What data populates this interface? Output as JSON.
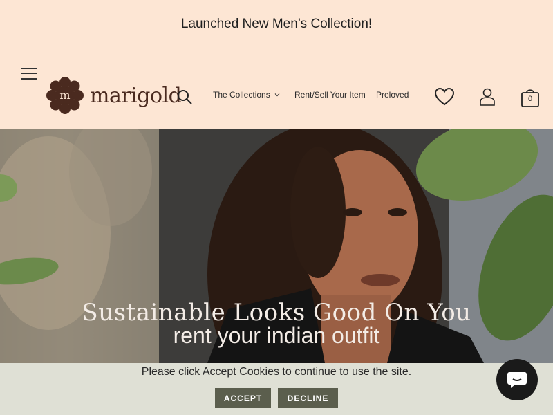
{
  "announcement": {
    "text": "Launched New Men’s Collection!"
  },
  "brand": {
    "name": "marigold",
    "logo_letter": "m",
    "accent": "#4a2a1f"
  },
  "nav": {
    "items": [
      {
        "label": "The Collections",
        "has_dropdown": true
      },
      {
        "label": "Rent/Sell Your Item"
      },
      {
        "label": "Preloved"
      }
    ]
  },
  "header_icons": {
    "menu": "hamburger-icon",
    "search": "search-icon",
    "wishlist": "heart-icon",
    "account": "user-icon",
    "cart": "bag-icon",
    "cart_count": "0"
  },
  "hero": {
    "title": "Sustainable Looks Good On You",
    "subtitle": "rent your indian outfit"
  },
  "cookie_banner": {
    "message": "Please click Accept Cookies to continue to use the site.",
    "accept_label": "ACCEPT",
    "decline_label": "DECLINE",
    "button_color": "#5b5e4d",
    "background": "#dfe0d5"
  },
  "chat": {
    "icon": "chat-bubble-icon"
  }
}
